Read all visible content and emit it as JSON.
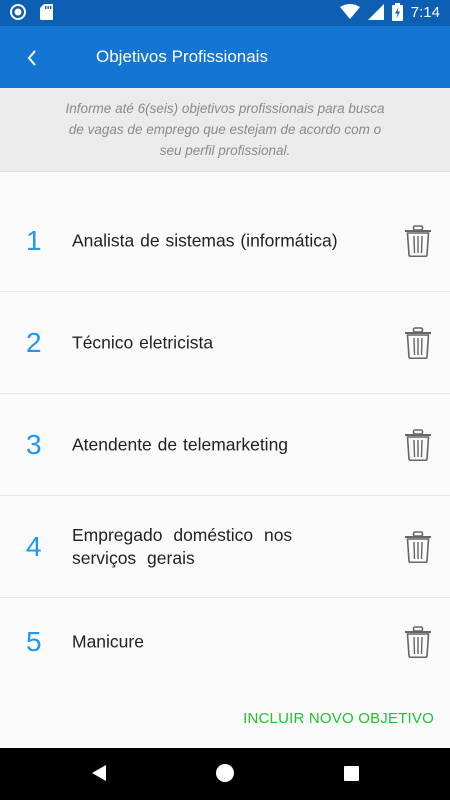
{
  "status": {
    "time": "7:14"
  },
  "header": {
    "title": "Objetivos Profissionais"
  },
  "info": {
    "text": "Informe até 6(seis) objetivos profissionais para busca de vagas de emprego que estejam de acordo com o seu perfil profissional."
  },
  "items": [
    {
      "number": "1",
      "label": "Analista de sistemas (informática)"
    },
    {
      "number": "2",
      "label": "Técnico eletricista"
    },
    {
      "number": "3",
      "label": "Atendente de telemarketing"
    },
    {
      "number": "4",
      "label": "Empregado doméstico nos serviços gerais"
    },
    {
      "number": "5",
      "label": "Manicure"
    }
  ],
  "actions": {
    "add_label": "INCLUIR NOVO OBJETIVO"
  },
  "colors": {
    "status_bar": "#0d5fb4",
    "app_bar": "#1476d2",
    "number": "#2196f3",
    "add_button": "#22c22c"
  },
  "icons": [
    "circle-notification-icon",
    "sd-card-icon",
    "wifi-icon",
    "signal-icon",
    "battery-charging-icon",
    "back-arrow-icon",
    "trash-icon"
  ]
}
